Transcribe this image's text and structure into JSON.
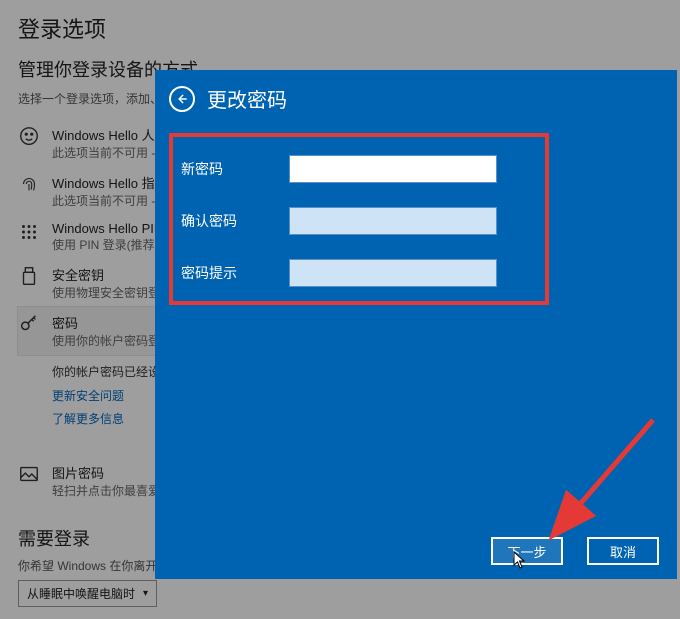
{
  "bg": {
    "title": "登录选项",
    "subtitle": "管理你登录设备的方式",
    "desc": "选择一个登录选项，添加、",
    "items": [
      {
        "label": "Windows Hello 人脸",
        "sub": "此选项当前不可用 -"
      },
      {
        "label": "Windows Hello 指纹",
        "sub": "此选项当前不可用 -"
      },
      {
        "label": "Windows Hello PIN",
        "sub": "使用 PIN 登录(推荐)"
      },
      {
        "label": "安全密钥",
        "sub": "使用物理安全密钥登"
      },
      {
        "label": "密码",
        "sub": "使用你的帐户密码登"
      },
      {
        "label": "图片密码",
        "sub": "轻扫并点击你最喜爱"
      }
    ],
    "pw_extra": "你的帐户密码已经设\n服务。",
    "pw_link1": "更新安全问题",
    "pw_link2": "了解更多信息",
    "require_title": "需要登录",
    "require_desc": "你希望 Windows 在你离开电",
    "dropdown_value": "从睡眠中唤醒电脑时"
  },
  "modal": {
    "title": "更改密码",
    "labels": {
      "new_pw": "新密码",
      "confirm_pw": "确认密码",
      "hint": "密码提示"
    },
    "buttons": {
      "next": "下一步",
      "cancel": "取消"
    }
  }
}
